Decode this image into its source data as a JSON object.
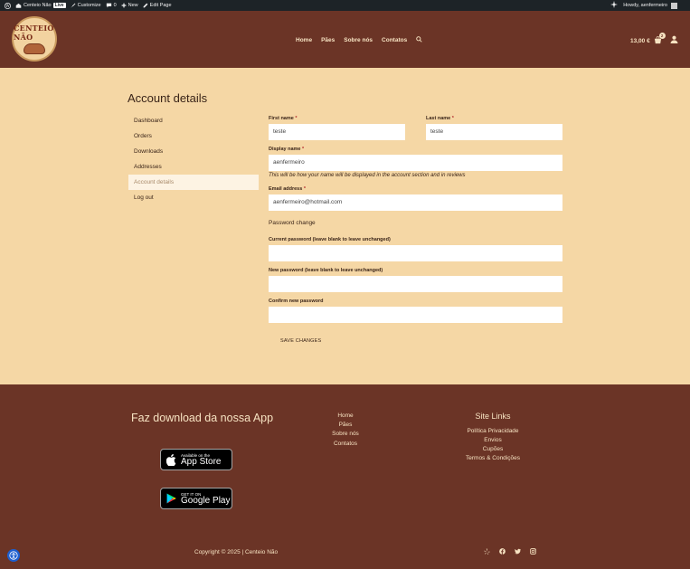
{
  "adminbar": {
    "site_name": "Centeio Não",
    "live_badge": "Live",
    "customize": "Customize",
    "comments_count": "0",
    "new": "New",
    "edit_page": "Edit Page",
    "howdy": "Howdy, aenfermeiro"
  },
  "header": {
    "logo_title": "CENTEIO NÃO",
    "nav": [
      "Home",
      "Pães",
      "Sobre nós",
      "Contatos"
    ],
    "cart_total": "13,00 €",
    "cart_count": "2"
  },
  "page": {
    "title": "Account details"
  },
  "account_nav": [
    "Dashboard",
    "Orders",
    "Downloads",
    "Addresses",
    "Account details",
    "Log out"
  ],
  "form": {
    "first_name_label": "First name",
    "first_name_value": "teste",
    "last_name_label": "Last name",
    "last_name_value": "teste",
    "display_name_label": "Display name",
    "display_name_value": "aenfermeiro",
    "display_name_hint": "This will be how your name will be displayed in the account section and in reviews",
    "email_label": "Email address",
    "email_value": "aenfermeiro@hotmail.com",
    "password_heading": "Password change",
    "current_password_label": "Current password (leave blank to leave unchanged)",
    "new_password_label": "New password (leave blank to leave unchanged)",
    "confirm_password_label": "Confirm new password",
    "save_button": "SAVE CHANGES",
    "required_mark": "*"
  },
  "footer": {
    "app_title": "Faz download da nossa App",
    "appstore_small": "Available on the",
    "appstore_big": "App Store",
    "googleplay_small": "GET IT ON",
    "googleplay_big": "Google Play",
    "links": [
      "Home",
      "Pães",
      "Sobre nós",
      "Contatos"
    ],
    "site_links_title": "Site Links",
    "site_links": [
      "Política Privacidade",
      "Envios",
      "Cupões",
      "Termos & Condições"
    ],
    "copyright": "Copyright © 2025 | Centeio Não",
    "social_icons": [
      "yelp-icon",
      "facebook-icon",
      "twitter-icon",
      "instagram-icon"
    ]
  },
  "colors": {
    "brown": "#6b3426",
    "cream": "#f5d7a5",
    "light_text": "#f7e3c2"
  }
}
